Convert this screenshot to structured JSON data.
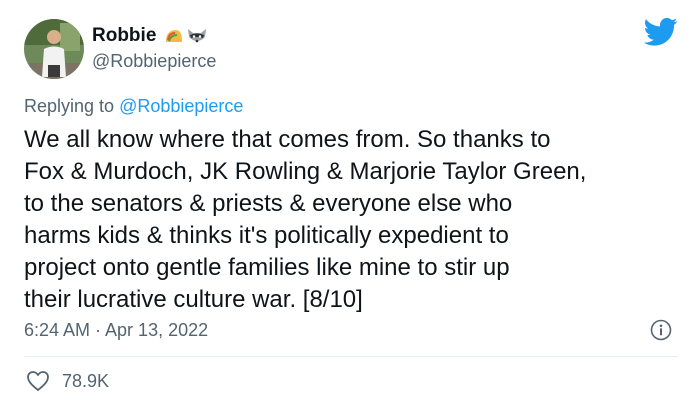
{
  "user": {
    "name": "Robbie",
    "handle": "@Robbiepierce",
    "emoji": [
      "taco-icon",
      "raccoon-icon"
    ]
  },
  "reply": {
    "prefix": "Replying to ",
    "mention": "@Robbiepierce"
  },
  "tweet": {
    "text": "We all know where that comes from. So thanks to\nFox & Murdoch, JK Rowling & Marjorie Taylor Green,\nto the senators & priests & everyone else who\nharms kids & thinks it's politically expedient to\nproject onto gentle families like mine to stir up\ntheir lucrative culture war. [8/10]",
    "timestamp": "6:24 AM · Apr 13, 2022"
  },
  "stats": {
    "likes": "78.9K"
  },
  "colors": {
    "twitter_blue": "#1d9bf0",
    "secondary_text": "#536471",
    "primary_text": "#0f1419"
  }
}
